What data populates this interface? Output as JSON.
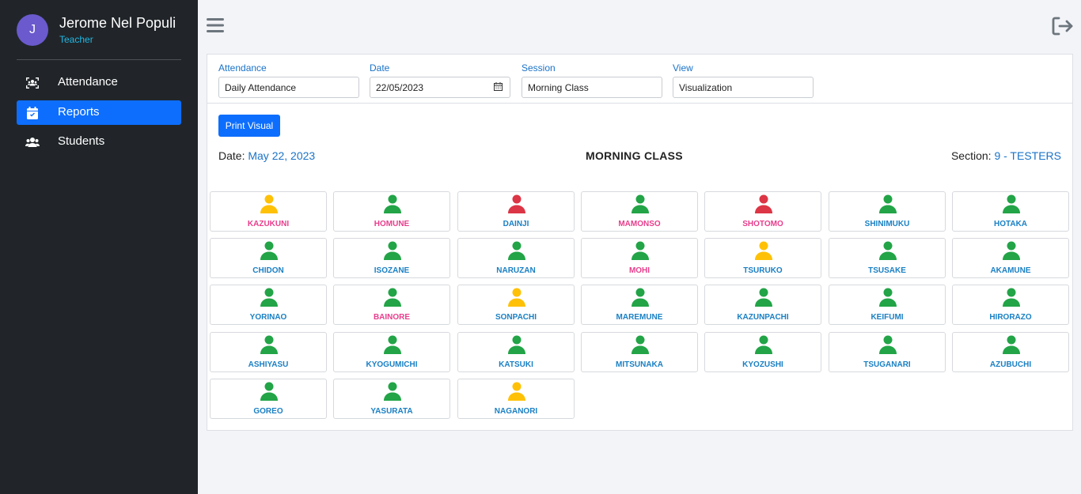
{
  "user": {
    "initial": "J",
    "name": "Jerome Nel Populi",
    "role": "Teacher"
  },
  "nav": [
    {
      "label": "Attendance",
      "icon": "scan-users-icon",
      "active": false
    },
    {
      "label": "Reports",
      "icon": "calendar-check-icon",
      "active": true
    },
    {
      "label": "Students",
      "icon": "users-icon",
      "active": false
    }
  ],
  "filters": {
    "attendance": {
      "label": "Attendance",
      "value": "Daily Attendance"
    },
    "date": {
      "label": "Date",
      "value": "22/05/2023"
    },
    "session": {
      "label": "Session",
      "value": "Morning Class"
    },
    "view": {
      "label": "View",
      "value": "Visualization"
    }
  },
  "print_label": "Print Visual",
  "header": {
    "date_label": "Date:",
    "date_value": "May 22, 2023",
    "title": "MORNING CLASS",
    "section_label": "Section:",
    "section_value": "9 - TESTERS"
  },
  "colors": {
    "present": "#22a447",
    "late": "#ffc107",
    "absent": "#dc3545",
    "name_male": "#1a80c4",
    "name_female": "#e83e8c"
  },
  "students": [
    {
      "name": "KAZUKUNI",
      "status": "late",
      "name_color": "female"
    },
    {
      "name": "HOMUNE",
      "status": "present",
      "name_color": "female"
    },
    {
      "name": "DAINJI",
      "status": "absent",
      "name_color": "male"
    },
    {
      "name": "MAMONSO",
      "status": "present",
      "name_color": "female"
    },
    {
      "name": "SHOTOMO",
      "status": "absent",
      "name_color": "female"
    },
    {
      "name": "SHINIMUKU",
      "status": "present",
      "name_color": "male"
    },
    {
      "name": "HOTAKA",
      "status": "present",
      "name_color": "male"
    },
    {
      "name": "CHIDON",
      "status": "present",
      "name_color": "male"
    },
    {
      "name": "ISOZANE",
      "status": "present",
      "name_color": "male"
    },
    {
      "name": "NARUZAN",
      "status": "present",
      "name_color": "male"
    },
    {
      "name": "MOHI",
      "status": "present",
      "name_color": "female"
    },
    {
      "name": "TSURUKO",
      "status": "late",
      "name_color": "male"
    },
    {
      "name": "TSUSAKE",
      "status": "present",
      "name_color": "male"
    },
    {
      "name": "AKAMUNE",
      "status": "present",
      "name_color": "male"
    },
    {
      "name": "YORINAO",
      "status": "present",
      "name_color": "male"
    },
    {
      "name": "BAINORE",
      "status": "present",
      "name_color": "female"
    },
    {
      "name": "SONPACHI",
      "status": "late",
      "name_color": "male"
    },
    {
      "name": "MAREMUNE",
      "status": "present",
      "name_color": "male"
    },
    {
      "name": "KAZUNPACHI",
      "status": "present",
      "name_color": "male"
    },
    {
      "name": "KEIFUMI",
      "status": "present",
      "name_color": "male"
    },
    {
      "name": "HIRORAZO",
      "status": "present",
      "name_color": "male"
    },
    {
      "name": "ASHIYASU",
      "status": "present",
      "name_color": "male"
    },
    {
      "name": "KYOGUMICHI",
      "status": "present",
      "name_color": "male"
    },
    {
      "name": "KATSUKI",
      "status": "present",
      "name_color": "male"
    },
    {
      "name": "MITSUNAKA",
      "status": "present",
      "name_color": "male"
    },
    {
      "name": "KYOZUSHI",
      "status": "present",
      "name_color": "male"
    },
    {
      "name": "TSUGANARI",
      "status": "present",
      "name_color": "male"
    },
    {
      "name": "AZUBUCHI",
      "status": "present",
      "name_color": "male"
    },
    {
      "name": "GOREO",
      "status": "present",
      "name_color": "male"
    },
    {
      "name": "YASURATA",
      "status": "present",
      "name_color": "male"
    },
    {
      "name": "NAGANORI",
      "status": "late",
      "name_color": "male"
    }
  ]
}
